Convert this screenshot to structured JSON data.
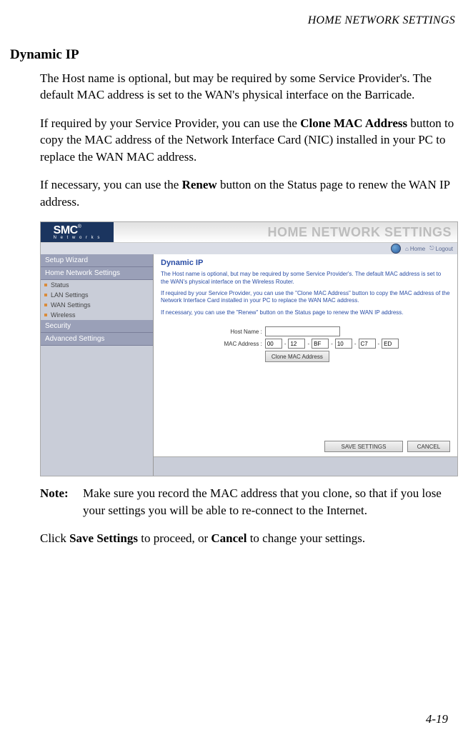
{
  "running_head": "HOME NETWORK SETTINGS",
  "heading": "Dynamic IP",
  "para1_a": "The Host name is optional, but may be required by some Service Provider's. The default MAC address is set to the WAN's physical interface on the Barricade.",
  "para2_a": "If required by your Service Provider, you can use the ",
  "para2_b": "Clone MAC Address",
  "para2_c": " button to copy the MAC address of the Network Interface Card (NIC) installed in your PC to replace the WAN MAC address.",
  "para3_a": "If necessary, you can use the ",
  "para3_b": "Renew",
  "para3_c": " button on the Status page to renew the WAN IP address.",
  "screenshot": {
    "logo": "SMC",
    "logo_r": "®",
    "logo_sub": "N e t w o r k s",
    "banner": "HOME NETWORK SETTINGS",
    "toolbar": {
      "home": "Home",
      "logout": "Logout"
    },
    "sidebar": {
      "h1": "Setup Wizard",
      "h2": "Home Network Settings",
      "items": [
        "Status",
        "LAN Settings",
        "WAN Settings",
        "Wireless"
      ],
      "h3": "Security",
      "h4": "Advanced Settings"
    },
    "content": {
      "title": "Dynamic IP",
      "p1": "The Host name is optional, but may be required by some Service Provider's. The default MAC address is set to the WAN's physical interface on the Wireless Router.",
      "p2": "If required by your Service Provider, you can use the \"Clone MAC Address\" button to copy the MAC address of the Network Interface Card installed in your PC to replace the WAN MAC address.",
      "p3": "If necessary, you can use the \"Renew\" button on the Status page to renew the WAN IP address.",
      "host_label": "Host Name :",
      "host_value": "",
      "mac_label": "MAC Address :",
      "mac": [
        "00",
        "12",
        "BF",
        "10",
        "C7",
        "ED"
      ],
      "clone_btn": "Clone MAC Address",
      "save_btn": "SAVE SETTINGS",
      "cancel_btn": "CANCEL"
    }
  },
  "note_label": "Note:",
  "note_text": "Make sure you record the MAC address that you clone, so that if you lose your settings you will be able to re-connect to the Internet.",
  "closing_a": "Click ",
  "closing_b": "Save Settings",
  "closing_c": " to proceed, or ",
  "closing_d": "Cancel",
  "closing_e": " to change your settings.",
  "page_num": "4-19"
}
